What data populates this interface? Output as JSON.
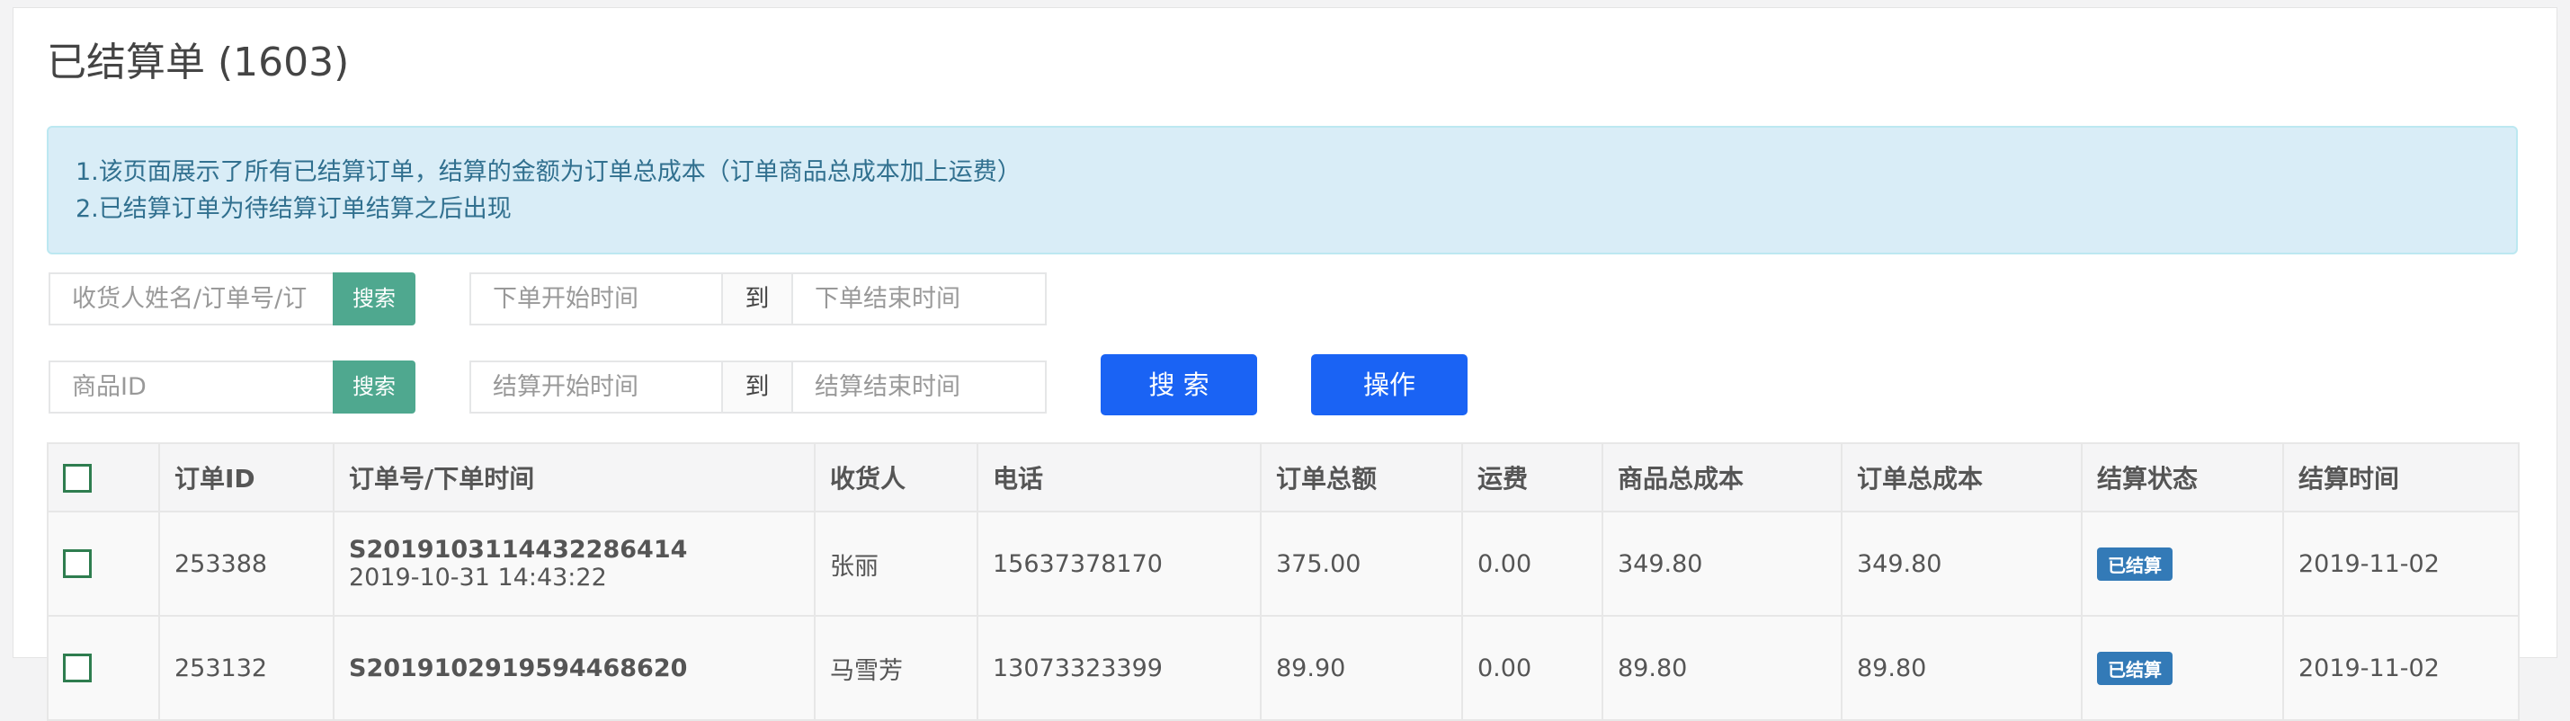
{
  "page": {
    "title": "已结算单 (1603)"
  },
  "notice": {
    "line1": "1.该页面展示了所有已结算订单，结算的金额为订单总成本（订单商品总成本加上运费）",
    "line2": "2.已结算订单为待结算订单结算之后出现"
  },
  "filters": {
    "keyword_placeholder": "收货人姓名/订单号/订",
    "search_label": "搜索",
    "order_start_placeholder": "下单开始时间",
    "to_label": "到",
    "order_end_placeholder": "下单结束时间",
    "product_id_placeholder": "商品ID",
    "settle_start_placeholder": "结算开始时间",
    "settle_end_placeholder": "结算结束时间",
    "main_search_label": "搜 索",
    "operate_label": "操作"
  },
  "table": {
    "headers": [
      "订单ID",
      "订单号/下单时间",
      "收货人",
      "电话",
      "订单总额",
      "运费",
      "商品总成本",
      "订单总成本",
      "结算状态",
      "结算时间"
    ],
    "rows": [
      {
        "id": "253388",
        "order_no": "S2019103114432286414",
        "order_time": "2019-10-31 14:43:22",
        "receiver": "张丽",
        "phone": "15637378170",
        "total": "375.00",
        "shipping": "0.00",
        "goods_cost": "349.80",
        "order_cost": "349.80",
        "status": "已结算",
        "settle_time": "2019-11-02"
      },
      {
        "id": "253132",
        "order_no": "S2019102919594468620",
        "order_time": "",
        "receiver": "马雪芳",
        "phone": "13073323399",
        "total": "89.90",
        "shipping": "0.00",
        "goods_cost": "89.80",
        "order_cost": "89.80",
        "status": "已结算",
        "settle_time": "2019-11-02"
      }
    ]
  },
  "colors": {
    "search_green": "#4fa88f",
    "primary_blue": "#1a63f4",
    "badge_blue": "#337ab7",
    "info_bg": "#d9edf7"
  }
}
